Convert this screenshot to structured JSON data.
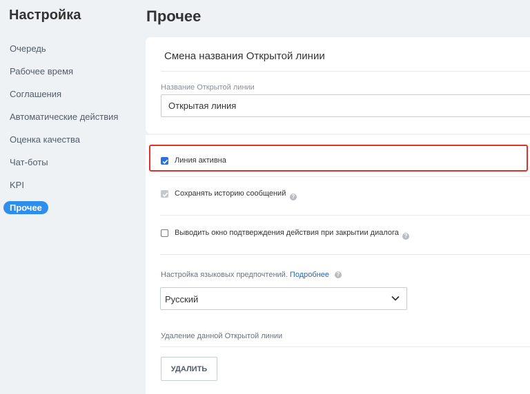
{
  "sidebar": {
    "title": "Настройка",
    "items": [
      {
        "label": "Очередь"
      },
      {
        "label": "Рабочее время"
      },
      {
        "label": "Соглашения"
      },
      {
        "label": "Автоматические действия"
      },
      {
        "label": "Оценка качества"
      },
      {
        "label": "Чат-боты"
      },
      {
        "label": "KPI"
      },
      {
        "label": "Прочее",
        "active": true
      }
    ]
  },
  "main": {
    "title": "Прочее",
    "rename_card": {
      "title": "Смена названия Открытой линии",
      "name_label": "Название Открытой линии",
      "name_value": "Открытая линия"
    },
    "options": {
      "line_active": {
        "label": "Линия активна",
        "checked": true
      },
      "save_history": {
        "label": "Сохранять историю сообщений",
        "checked": true,
        "disabled": true
      },
      "confirm_close": {
        "label": "Выводить окно подтверждения действия при закрытии диалога",
        "checked": false
      }
    },
    "language": {
      "label": "Настройка языковых предпочтений.",
      "link": "Подробнее",
      "selected": "Русский"
    },
    "delete": {
      "label": "Удаление данной Открытой линии",
      "button_label": "УДАЛИТЬ"
    }
  },
  "colors": {
    "accent": "#2f8ded",
    "checkbox": "#2b6fe0",
    "highlight_border": "#e0302a",
    "link": "#2067b0"
  },
  "icons": [
    "help-icon",
    "chevron-down-icon",
    "checkmark-icon"
  ]
}
